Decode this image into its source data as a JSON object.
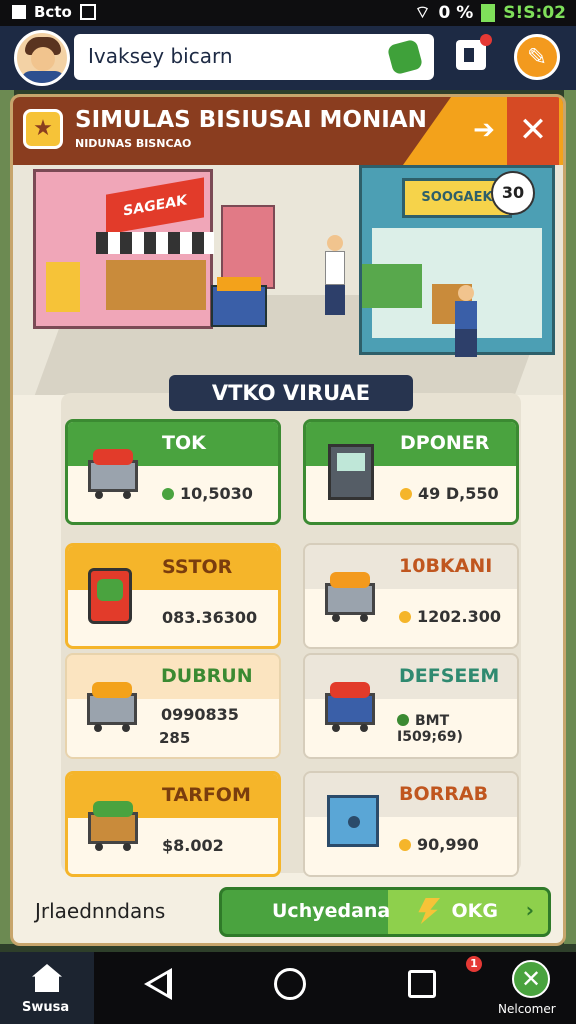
{
  "status_bar": {
    "carrier": "Bcto",
    "battery_text": "0 %",
    "time": "S!S:02"
  },
  "top_bar": {
    "player_name": "Ivaksey bicarn"
  },
  "panel": {
    "title": "SIMULAS BISIUSAI MONIAN",
    "subtitle": "NIDUNAS BISNCAO",
    "scene": {
      "left_sign": "SAGEAK",
      "right_sign": "SOOGAEK",
      "badge": "30"
    },
    "section_label": "VTKO VIRUAE",
    "items": [
      {
        "title": "TOK",
        "value": "10,5030",
        "value2": "",
        "style": "green",
        "icon": "shopping-cart-icon",
        "coin_color": "#4aa33f"
      },
      {
        "title": "DPONER",
        "value": "49 D,550",
        "value2": "",
        "style": "green",
        "icon": "cash-register-icon",
        "coin_color": "#f5b52a"
      },
      {
        "title": "SSTOR",
        "value": "083.36300",
        "value2": "",
        "style": "orange",
        "icon": "phone-icon",
        "coin_color": ""
      },
      {
        "title": "10BKANI",
        "value": "1202.300",
        "value2": "",
        "style": "gray",
        "icon": "produce-cart-icon",
        "coin_color": "#f5b52a"
      },
      {
        "title": "DUBRUN",
        "value": "0990835",
        "value2": "285",
        "style": "peach",
        "icon": "loaded-cart-icon",
        "coin_color": ""
      },
      {
        "title": "DEFSEEM",
        "value": "BMT I509;69)",
        "value2": "",
        "style": "mint",
        "icon": "blue-cart-icon",
        "coin_color": "#3b8a32"
      },
      {
        "title": "TARFOM",
        "value": "$8.002",
        "value2": "",
        "style": "orange",
        "icon": "basket-icon",
        "coin_color": ""
      },
      {
        "title": "BORRAB",
        "value": "90,990",
        "value2": "",
        "style": "gray",
        "icon": "safe-icon",
        "coin_color": "#f5b52a"
      }
    ],
    "footer_text": "Jrlaednndans",
    "action_button": {
      "label": "Uchyedana",
      "ok_label": "OKG"
    }
  },
  "nav_bar": {
    "home_label": "Swusa",
    "badge": "1",
    "right_label": "Nelcomer"
  }
}
